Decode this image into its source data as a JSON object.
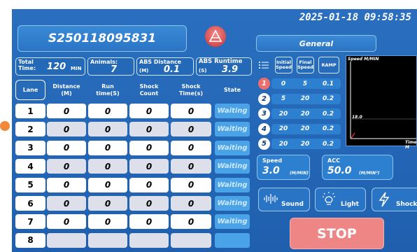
{
  "datetime": "2025-01-18 09:58:35",
  "device_id": "S250118095831",
  "mode": "General",
  "stats": {
    "total_time": {
      "label_1": "Total",
      "label_2": "Time:",
      "value": "120",
      "unit": "MIN"
    },
    "animals": {
      "label": "Animals:",
      "value": "7"
    },
    "abs_distance": {
      "label": "ABS Distance",
      "unit": "(M)",
      "value": "0.1"
    },
    "abs_runtime": {
      "label": "ABS Runtime",
      "unit": "(S)",
      "value": "3.9"
    }
  },
  "table": {
    "headers": {
      "lane": "Lane",
      "distance": "Distance\n(M)",
      "run_time": "Run\ntime(S)",
      "shock_count": "Shock\nCount",
      "shock_time": "Shock\nTime(s)",
      "state": "State"
    },
    "rows": [
      {
        "lane": "1",
        "distance": "0",
        "run_time": "0",
        "shock_count": "0",
        "shock_time": "0",
        "state": "Waiting"
      },
      {
        "lane": "2",
        "distance": "0",
        "run_time": "0",
        "shock_count": "0",
        "shock_time": "0",
        "state": "Waiting"
      },
      {
        "lane": "3",
        "distance": "0",
        "run_time": "0",
        "shock_count": "0",
        "shock_time": "0",
        "state": "Waiting"
      },
      {
        "lane": "4",
        "distance": "0",
        "run_time": "0",
        "shock_count": "0",
        "shock_time": "0",
        "state": "Waiting"
      },
      {
        "lane": "5",
        "distance": "0",
        "run_time": "0",
        "shock_count": "0",
        "shock_time": "0",
        "state": "Waiting"
      },
      {
        "lane": "6",
        "distance": "0",
        "run_time": "0",
        "shock_count": "0",
        "shock_time": "0",
        "state": "Waiting"
      },
      {
        "lane": "7",
        "distance": "0",
        "run_time": "0",
        "shock_count": "0",
        "shock_time": "0",
        "state": "Waiting"
      },
      {
        "lane": "8",
        "distance": "",
        "run_time": "",
        "shock_count": "",
        "shock_time": "",
        "state": ""
      }
    ]
  },
  "program": {
    "headers": {
      "initial": "Initial\nSpeed",
      "final": "Final\nSpeed",
      "ramp": "RAMP"
    },
    "steps": [
      {
        "num": "1",
        "initial": "0",
        "final": "5",
        "ramp": "0.1",
        "active": true
      },
      {
        "num": "2",
        "initial": "5",
        "final": "20",
        "ramp": "0.2",
        "active": false
      },
      {
        "num": "3",
        "initial": "20",
        "final": "20",
        "ramp": "0.2",
        "active": false
      },
      {
        "num": "4",
        "initial": "20",
        "final": "20",
        "ramp": "0.2",
        "active": false
      },
      {
        "num": "5",
        "initial": "20",
        "final": "20",
        "ramp": "0.2",
        "active": false
      }
    ]
  },
  "chart": {
    "y_label": "Speed M/MIN",
    "x_label": "Time M",
    "marker_value": "18.0"
  },
  "speed": {
    "label": "Speed",
    "value": "3.0",
    "unit": "(M/MIN)"
  },
  "acc": {
    "label": "ACC",
    "value": "50.0",
    "unit": "(M/MIN²)"
  },
  "controls": {
    "sound": "Sound",
    "light": "Light",
    "shock": "Shock"
  },
  "stop_label": "STOP",
  "colors": {
    "accent": "#2a6fbf",
    "stop": "#ef8686",
    "active_step": "#f06d6d"
  }
}
